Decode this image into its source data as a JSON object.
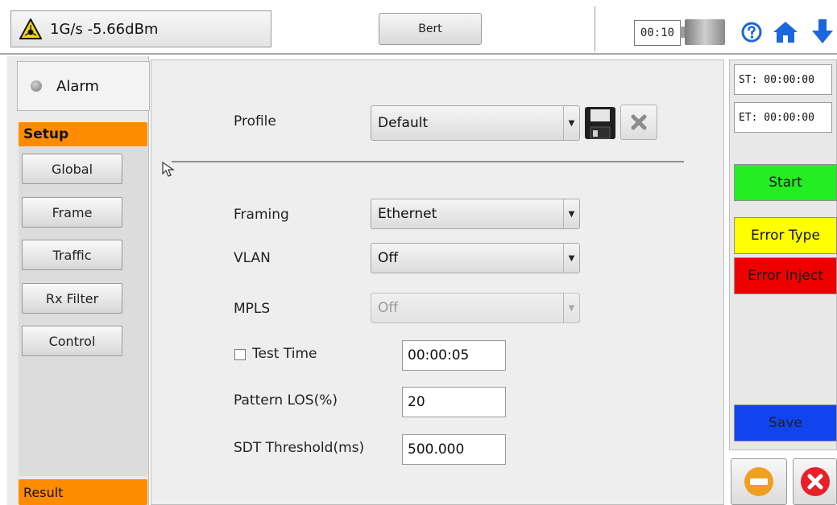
{
  "topbar": {
    "status_text": "1G/s -5.66dBm",
    "status_icon": "laser-warning-icon",
    "mode_button": "Bert",
    "timer": "00:10",
    "icons": [
      "battery-icon",
      "help-icon",
      "home-icon",
      "down-arrow-icon"
    ]
  },
  "sidebar": {
    "alarm_label": "Alarm",
    "setup_header": "Setup",
    "items": [
      {
        "label": "Global"
      },
      {
        "label": "Frame"
      },
      {
        "label": "Traffic"
      },
      {
        "label": "Rx Filter"
      },
      {
        "label": "Control"
      }
    ],
    "result_header": "Result"
  },
  "form": {
    "profile": {
      "label": "Profile",
      "value": "Default"
    },
    "framing": {
      "label": "Framing",
      "value": "Ethernet"
    },
    "vlan": {
      "label": "VLAN",
      "value": "Off"
    },
    "mpls": {
      "label": "MPLS",
      "value": "Off",
      "disabled": true
    },
    "test_time": {
      "label": "Test Time",
      "value": "00:00:05",
      "checked": false
    },
    "pattern_los": {
      "label": "Pattern LOS(%)",
      "value": "20"
    },
    "sdt_threshold": {
      "label": "SDT Threshold(ms)",
      "value": "500.000"
    }
  },
  "right_panel": {
    "start_time": "ST:  00:00:00",
    "end_time": "ET:  00:00:00",
    "start_button": "Start",
    "error_type_button": "Error Type",
    "error_inject_button": "Error Inject",
    "save_button": "Save"
  },
  "colors": {
    "accent_orange": "#ff8c00",
    "start_green": "#22ee22",
    "error_type_yellow": "#ffff00",
    "error_inject_red": "#ee0000",
    "save_blue": "#1144ee",
    "icon_blue": "#1a66dd"
  }
}
